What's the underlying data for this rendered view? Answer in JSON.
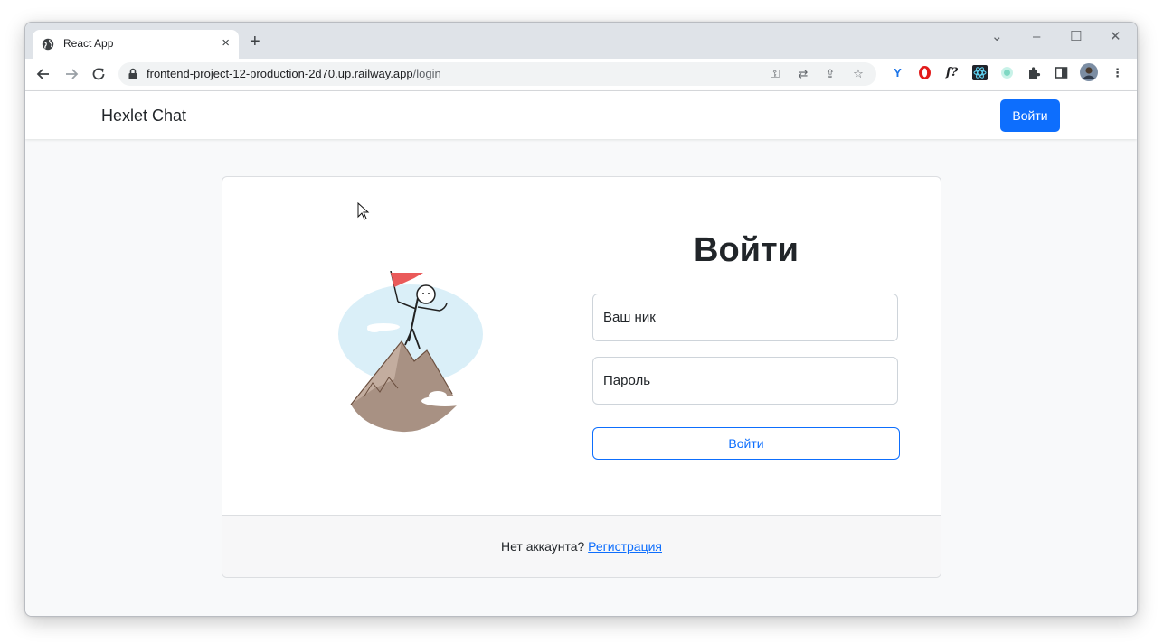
{
  "browser": {
    "tab": {
      "title": "React App",
      "close": "×"
    },
    "new_tab": "+",
    "window_controls": {
      "minimize": "–",
      "maximize": "☐",
      "close": "✕",
      "tab_search": "⌄"
    },
    "address": {
      "host": "frontend-project-12-production-2d70.up.railway.app",
      "path": "/login"
    },
    "extension_letters": {
      "f": "f?"
    }
  },
  "app": {
    "brand": "Hexlet Chat",
    "nav_login": "Войти",
    "accent_color": "#0d6efd"
  },
  "login": {
    "title": "Войти",
    "username_placeholder": "Ваш ник",
    "password_placeholder": "Пароль",
    "submit": "Войти",
    "footer_text": "Нет аккаунта? ",
    "footer_link": "Регистрация"
  }
}
